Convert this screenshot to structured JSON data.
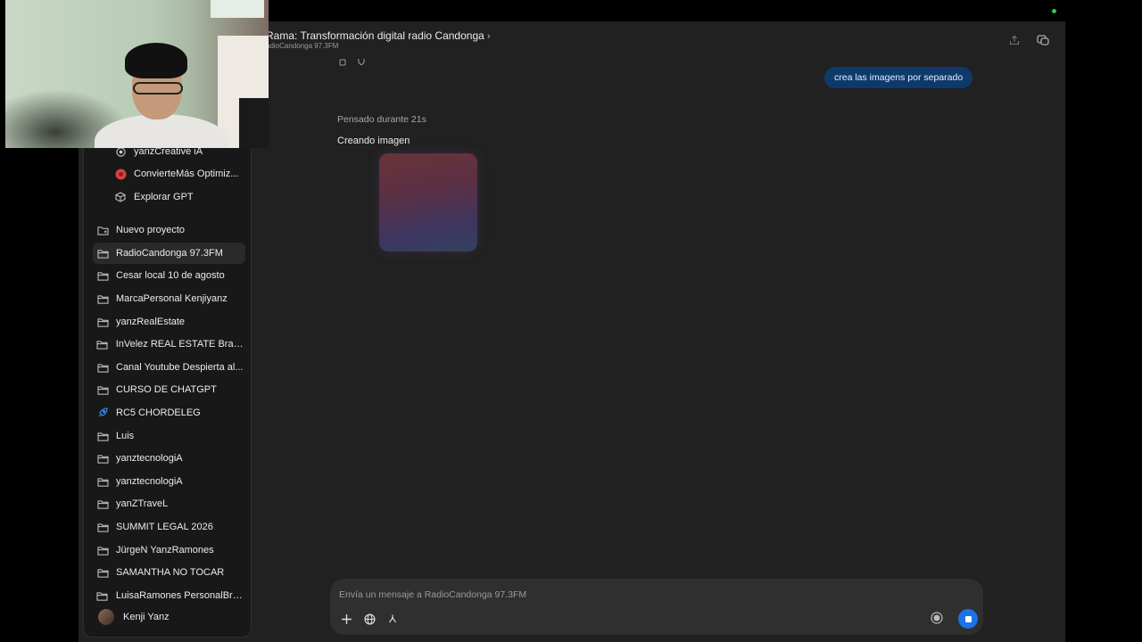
{
  "header": {
    "title": "Rama: Transformación digital radio Candonga",
    "subtitle": "adioCandonga 97.3FM",
    "chevron": "›"
  },
  "sidebar": {
    "gpts": [
      {
        "label": "yanzCreative iA",
        "icon": "gpt-icon"
      },
      {
        "label": "ConvierteMás Optimiz...",
        "icon": "red-dot-icon"
      },
      {
        "label": "Explorar GPT",
        "icon": "cube-icon"
      }
    ],
    "projects": [
      {
        "label": "Nuevo proyecto",
        "icon": "new-folder-icon"
      },
      {
        "label": "RadioCandonga 97.3FM",
        "icon": "folder-icon",
        "active": true
      },
      {
        "label": "Cesar local 10 de agosto",
        "icon": "folder-icon"
      },
      {
        "label": "MarcaPersonal Kenjiyanz",
        "icon": "folder-icon"
      },
      {
        "label": "yanzRealEstate",
        "icon": "folder-icon"
      },
      {
        "label": "InVelez REAL ESTATE Bran...",
        "icon": "folder-icon"
      },
      {
        "label": "Canal Youtube Despierta al...",
        "icon": "folder-icon"
      },
      {
        "label": "CURSO DE CHATGPT",
        "icon": "folder-icon"
      },
      {
        "label": "RC5 CHORDELEG",
        "icon": "rocket-icon"
      },
      {
        "label": "Luis",
        "icon": "folder-icon"
      },
      {
        "label": "yanztecnologiA",
        "icon": "folder-icon"
      },
      {
        "label": "yanztecnologiA",
        "icon": "folder-icon"
      },
      {
        "label": "yanZTraveL",
        "icon": "folder-icon"
      },
      {
        "label": "SUMMIT LEGAL 2026",
        "icon": "folder-icon"
      },
      {
        "label": "JürgeN YanzRamones",
        "icon": "folder-icon"
      },
      {
        "label": "SAMANTHA NO TOCAR",
        "icon": "folder-icon"
      },
      {
        "label": "LuisaRamones PersonalBra...",
        "icon": "folder-icon"
      }
    ],
    "user": {
      "name": "Kenji Yanz"
    }
  },
  "messages": {
    "user_message": "crea las imagens por separado",
    "thought_label": "Pensado durante 21s",
    "status_label": "Creando imagen"
  },
  "composer": {
    "placeholder": "Envía un mensaje a RadioCandonga 97.3FM",
    "value": ""
  },
  "colors": {
    "background": "#212121",
    "sidebar": "#181818",
    "user_bubble": "#0e3a6b",
    "stop_button": "#1d72e8",
    "composer": "#2f2f2f"
  }
}
